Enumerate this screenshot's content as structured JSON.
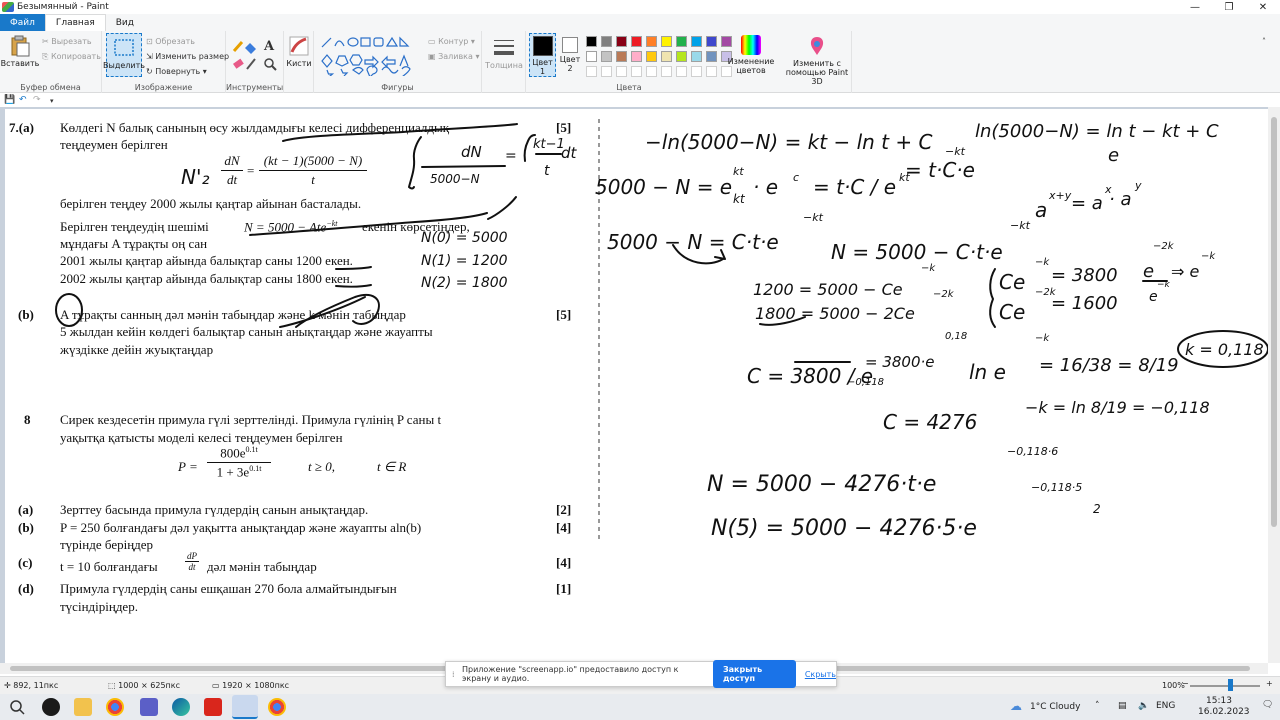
{
  "window": {
    "title": "Безымянный - Paint",
    "minimize": "—",
    "maximize": "❐",
    "close": "✕"
  },
  "tabs": [
    "Файл",
    "Главная",
    "Вид"
  ],
  "ribbon": {
    "clipboard": {
      "paste": "Вставить",
      "cut": "Вырезать",
      "copy": "Копировать",
      "label": "Буфер обмена"
    },
    "image": {
      "select": "Выделить",
      "crop": "Обрезать",
      "resize": "Изменить размер",
      "rotate": "Повернуть",
      "label": "Изображение"
    },
    "tools": {
      "label": "Инструменты",
      "text_tool": "A"
    },
    "brushes": {
      "label": "Кисти"
    },
    "shapes": {
      "outline": "Контур",
      "fill": "Заливка",
      "label": "Фигуры"
    },
    "size": {
      "label": "Толщина"
    },
    "colors": {
      "color1": "Цвет 1",
      "color2": "Цвет 2",
      "edit": "Изменение цветов",
      "label": "Цвета",
      "palette": [
        "#000000",
        "#7f7f7f",
        "#880015",
        "#ed1c24",
        "#ff7f27",
        "#fff200",
        "#22b14c",
        "#00a2e8",
        "#3f48cc",
        "#a349a4",
        "#ffffff",
        "#c3c3c3",
        "#b97a57",
        "#ffaec9",
        "#ffc90e",
        "#efe4b0",
        "#b5e61d",
        "#99d9ea",
        "#7092be",
        "#c8bfe7"
      ]
    },
    "paint3d": {
      "label": "Изменить с помощью Paint 3D"
    }
  },
  "document": {
    "q7": "7.(a)",
    "q7_line1": "Көлдегі N балық санының өсу жылдамдығы келесі дифференциалдық",
    "q7_line2": "теңдеумен берілген",
    "q7_marks_a": "[5]",
    "eq_lhs_num": "dN",
    "eq_lhs_den": "dt",
    "eq_rhs_num": "(kt − 1)(5000 − N)",
    "eq_rhs_den": "t",
    "q7_line3": "берілген теңдеу 2000 жылы қаңтар айынан басталады.",
    "q7_line4a": "Берілген теңдеудің шешімі",
    "q7_solution": "N = 5000 − Ate",
    "q7_solution_exp": "−kt",
    "q7_line4b": "екенін көрсетіңдер,",
    "q7_line5": "мұндағы A тұрақты оң сан",
    "q7_line6": "2001 жылы қаңтар айында балықтар саны 1200 екен.",
    "q7_line7": "2002 жылы қаңтар айында балықтар саны 1800 екен.",
    "q7b": "(b)",
    "q7b_line1": "A тұрақты санның дәл мәнін табыңдар және k мәнін табыңдар",
    "q7b_line2": "5 жылдан кейін көлдегі балықтар санын анықтаңдар және жауапты",
    "q7b_line3": "жүздікке дейін жуықтаңдар",
    "q7b_marks": "[5]",
    "q8": "8",
    "q8_line1": "Сирек кездесетін примула гүлі зерттелінді. Примула гүлінің P саны t",
    "q8_line2": "уақытқа қатысты моделі келесі теңдеумен берілген",
    "q8_eq_lhs": "P =",
    "q8_eq_num": "800e",
    "q8_eq_num_exp": "0.1t",
    "q8_eq_den": "1 + 3e",
    "q8_eq_den_exp": "0.1t",
    "q8_eq_cond1": "t ≥ 0,",
    "q8_eq_cond2": "t ∈ R",
    "q8a": "(a)",
    "q8a_text": "Зерттеу басында примула гүлдердің санын анықтаңдар.",
    "q8a_marks": "[2]",
    "q8b": "(b)",
    "q8b_text1": "P = 250 болғандағы дәл уақытта анықтаңдар және жауапты aln(b)",
    "q8b_text2": "түрінде беріңдер",
    "q8b_marks": "[4]",
    "q8c": "(c)",
    "q8c_text_a": "t = 10 болғандағы",
    "q8c_frac_num": "dP",
    "q8c_frac_den": "dt",
    "q8c_text_b": "дәл мәнін табыңдар",
    "q8c_marks": "[4]",
    "q8d": "(d)",
    "q8d_text1": "Примула гүлдердің саны ешқашан 270 бола алмайтындығын",
    "q8d_text2": "түсіндіріңдер.",
    "q8d_marks": "[1]"
  },
  "handwriting": {
    "h1": "−ln(5000−N) = kt − ln t + C",
    "h2": "ln(5000−N) = ln t − kt + C",
    "h3": "5000 − N = e",
    "h4": "· e",
    "h5": "= t·C / e",
    "h6": "= t·C·e",
    "h7": "5000 − N = C·t·e",
    "h8": "N = 5000 − C·t·e",
    "h9": "a",
    "h10": "= a",
    "h11": "· a",
    "h12": "1200 = 5000 − Ce",
    "h13": "1800 = 5000 − 2Ce",
    "h14": "Ce",
    "h15": "= 3800",
    "h16": "Ce",
    "h17": "= 1600",
    "h18": "C = 3800 / e",
    "h19": "= 3800·e",
    "h20": "ln e",
    "h21": "= 16/38 = 8/19",
    "h22": "k = 0,118",
    "h23": "C = 4276",
    "h24": "−k = ln 8/19 = −0,118",
    "h25": "N = 5000 − 4276·t·e",
    "h26": "−0,118·6",
    "h27": "N(5) = 5000 − 4276·5·e",
    "h28": "−0,118·5",
    "h29": "N(0) = 5000",
    "h30": "N(1) = 1200",
    "h31": "N(2) = 1800",
    "h32": "∫ dN / 5000−N = ∫ kt−1 / t dt",
    "h33": "2"
  },
  "status": {
    "cursor": "892, 11пкс",
    "selection": "1000 × 625пкс",
    "canvas_size": "1920 × 1080пкс",
    "zoom": "100%"
  },
  "banner": {
    "message": "Приложение \"screenapp.io\" предоставило доступ к экрану и аудио.",
    "stop_button": "Закрыть доступ",
    "hide_link": "Скрыть"
  },
  "taskbar": {
    "weather": "1°C  Cloudy",
    "lang": "ENG",
    "time": "15:13",
    "date": "16.02.2023"
  }
}
